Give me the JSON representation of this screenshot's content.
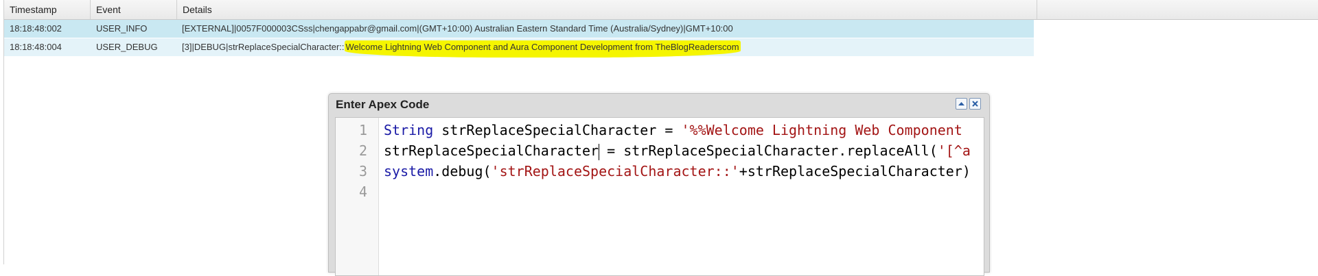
{
  "log_table": {
    "columns": [
      "Timestamp",
      "Event",
      "Details"
    ],
    "rows": [
      {
        "timestamp": "18:18:48:002",
        "event": "USER_INFO",
        "details": "[EXTERNAL]|0057F000003CSss|chengappabr@gmail.com|(GMT+10:00) Australian Eastern Standard Time (Australia/Sydney)|GMT+10:00"
      },
      {
        "timestamp": "18:18:48:004",
        "event": "USER_DEBUG",
        "details_prefix": "[3]|DEBUG|strReplaceSpecialCharacter::",
        "details_highlight": "Welcome Lightning Web Component and Aura Component Development from TheBlogReaderscom"
      }
    ],
    "highlight_color": "#f5f500"
  },
  "dialog": {
    "title": "Enter Apex Code",
    "line_numbers": [
      "1",
      "2",
      "3",
      "4"
    ],
    "code": {
      "line1_kw": "String",
      "line1_mid": " strReplaceSpecialCharacter = ",
      "line1_str": "'%%Welcome Lightning Web Component",
      "line2_a": "strReplaceSpecialCharacter",
      "line2_b": " = strReplaceSpecialCharacter.replaceAll(",
      "line2_str": "'[^a",
      "line3_kw": "system",
      "line3_mid": ".debug(",
      "line3_str": "'strReplaceSpecialCharacter::'",
      "line3_end": "+strReplaceSpecialCharacter)"
    }
  }
}
